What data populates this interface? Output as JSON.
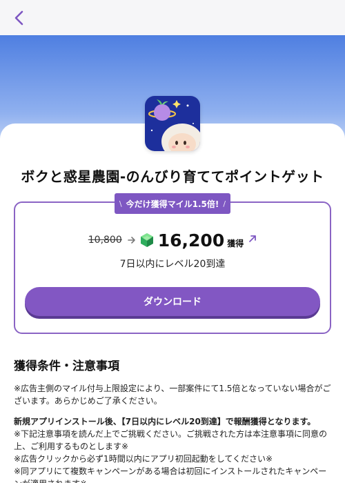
{
  "app": {
    "title": "ボクと惑星農園-のんびり育ててポイントゲット"
  },
  "offer": {
    "ribbon_left": "\\",
    "ribbon_text": "今だけ獲得マイル1.5倍!",
    "ribbon_right": "/",
    "old_points": "10,800",
    "new_points": "16,200",
    "earn_label": "獲得",
    "condition": "7日以内にレベル20到達",
    "download_label": "ダウンロード"
  },
  "conditions": {
    "title": "獲得条件・注意事項",
    "note1": "※広告主側のマイル付与上限設定により、一部案件にて1.5倍となっていない場合がございます。あらかじめご了承ください。",
    "bold_line": "新規アプリインストール後、【7日以内にレベル20到達】で報酬獲得となります。",
    "note2": "※下記注意事項を読んだ上でご挑戦ください。ご挑戦された方は本注意事項に同意の上、ご利用するものとします※",
    "note3": "※広告クリックから必ず1時間以内にアプリ初回起動をしてください※",
    "note4": "※同アプリにて複数キャンペーンがある場合は初回にインストールされたキャンペーンが適用されます※"
  },
  "colors": {
    "accent": "#7e57c2",
    "button": "#8257c3",
    "hero_top": "#4f7fe1",
    "gem": "#3cc07a"
  },
  "icons": {
    "back": "chevron-left-icon",
    "gem": "gem-icon",
    "arrow": "arrow-right-icon",
    "external": "arrow-up-right-icon"
  }
}
